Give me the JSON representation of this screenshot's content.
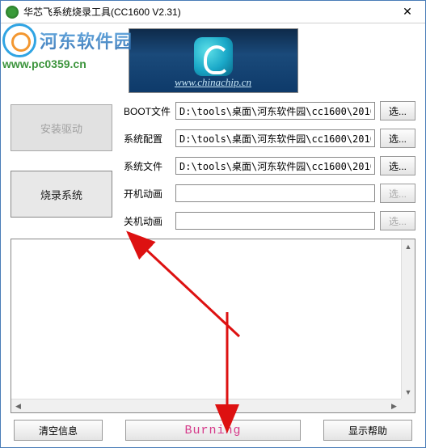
{
  "window": {
    "title": "华芯飞系统烧录工具(CC1600 V2.31)"
  },
  "watermark": {
    "brand": "河东软件园",
    "url": "www.pc0359.cn"
  },
  "banner": {
    "url": "www.chinachip.cn"
  },
  "buttons": {
    "install_driver": "安装驱动",
    "burn_system": "烧录系统"
  },
  "fields": [
    {
      "label": "BOOT文件",
      "value": "D:\\tools\\桌面\\河东软件园\\cc1600\\2010",
      "browse": "选...",
      "enabled": true
    },
    {
      "label": "系统配置",
      "value": "D:\\tools\\桌面\\河东软件园\\cc1600\\2010",
      "browse": "选...",
      "enabled": true
    },
    {
      "label": "系统文件",
      "value": "D:\\tools\\桌面\\河东软件园\\cc1600\\2010",
      "browse": "选...",
      "enabled": true
    },
    {
      "label": "开机动画",
      "value": "",
      "browse": "选...",
      "enabled": false
    },
    {
      "label": "关机动画",
      "value": "",
      "browse": "选...",
      "enabled": false
    }
  ],
  "bottom": {
    "clear": "清空信息",
    "burn": "Burning",
    "help": "显示帮助"
  }
}
